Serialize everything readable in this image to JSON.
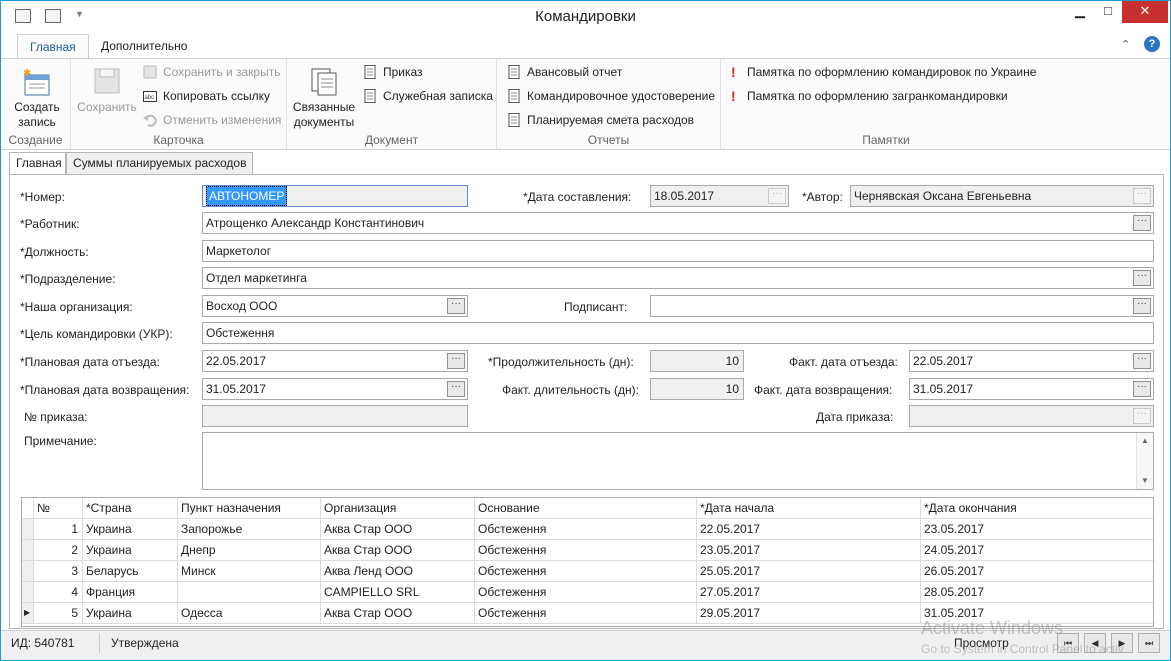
{
  "window": {
    "title": "Командировки",
    "minimize": "▁",
    "maximize": "□",
    "close": "✕"
  },
  "ribbon_tabs": [
    "Главная",
    "Дополнительно"
  ],
  "ribbon": {
    "create": {
      "label1": "Создать",
      "label2": "запись",
      "group": "Создание"
    },
    "save": "Сохранить",
    "card_group": "Карточка",
    "save_close": "Сохранить и закрыть",
    "copy_link": "Копировать ссылку",
    "undo": "Отменить изменения",
    "linked": {
      "label1": "Связанные",
      "label2": "документы"
    },
    "doc_group": "Документ",
    "order": "Приказ",
    "memo": "Служебная записка",
    "reports_group": "Отчеты",
    "advance": "Авансовый отчет",
    "certificate": "Командировочное удостоверение",
    "estimate": "Планируемая смета расходов",
    "notes_group": "Памятки",
    "note1": "Памятка по оформлению командировок по Украине",
    "note2": "Памятка по оформлению загранкомандировки"
  },
  "form_tabs": [
    "Главная",
    "Суммы планируемых расходов"
  ],
  "form": {
    "number_label": "*Номер:",
    "number_value": "АВТОНОМЕР",
    "date_label": "*Дата составления:",
    "date_value": "18.05.2017",
    "author_label": "*Автор:",
    "author_value": "Чернявская Оксана Евгеньевна",
    "employee_label": "*Работник:",
    "employee_value": "Атрощенко Александр Константинович",
    "position_label": "*Должность:",
    "position_value": "Маркетолог",
    "dept_label": "*Подразделение:",
    "dept_value": "Отдел маркетинга",
    "org_label": "*Наша организация:",
    "org_value": "Восход ООО",
    "signer_label": "Подписант:",
    "signer_value": "",
    "purpose_label": "*Цель командировки (УКР):",
    "purpose_value": "Обстеження",
    "plan_dep_label": "*Плановая дата отъезда:",
    "plan_dep_value": "22.05.2017",
    "duration_label": "*Продолжительность (дн):",
    "duration_value": "10",
    "fact_dep_label": "Факт. дата отъезда:",
    "fact_dep_value": "22.05.2017",
    "plan_ret_label": "*Плановая дата возвращения:",
    "plan_ret_value": "31.05.2017",
    "fact_dur_label": "Факт. длительность (дн):",
    "fact_dur_value": "10",
    "fact_ret_label": "Факт. дата возвращения:",
    "fact_ret_value": "31.05.2017",
    "order_no_label": "№ приказа:",
    "order_no_value": "",
    "order_date_label": "Дата приказа:",
    "order_date_value": "",
    "note_label": "Примечание:",
    "note_value": ""
  },
  "grid": {
    "columns": [
      "№",
      "*Страна",
      "Пункт назначения",
      "Организация",
      "Основание",
      "*Дата начала",
      "*Дата окончания"
    ],
    "rows": [
      [
        "1",
        "Украина",
        "Запорожье",
        "Аква Стар ООО",
        "Обстеження",
        "22.05.2017",
        "23.05.2017"
      ],
      [
        "2",
        "Украина",
        "Днепр",
        "Аква Стар ООО",
        "Обстеження",
        "23.05.2017",
        "24.05.2017"
      ],
      [
        "3",
        "Беларусь",
        "Минск",
        "Аква Ленд ООО",
        "Обстеження",
        "25.05.2017",
        "26.05.2017"
      ],
      [
        "4",
        "Франция",
        "",
        "CAMPIELLO SRL",
        "Обстеження",
        "27.05.2017",
        "28.05.2017"
      ],
      [
        "5",
        "Украина",
        "Одесса",
        "Аква Стар ООО",
        "Обстеження",
        "29.05.2017",
        "31.05.2017"
      ]
    ]
  },
  "status": {
    "id": "ИД: 540781",
    "state": "Утверждена",
    "mode": "Просмотр"
  },
  "watermark": {
    "line1": "Activate Windows",
    "line2": "Go to System in Control Panel to activ"
  }
}
